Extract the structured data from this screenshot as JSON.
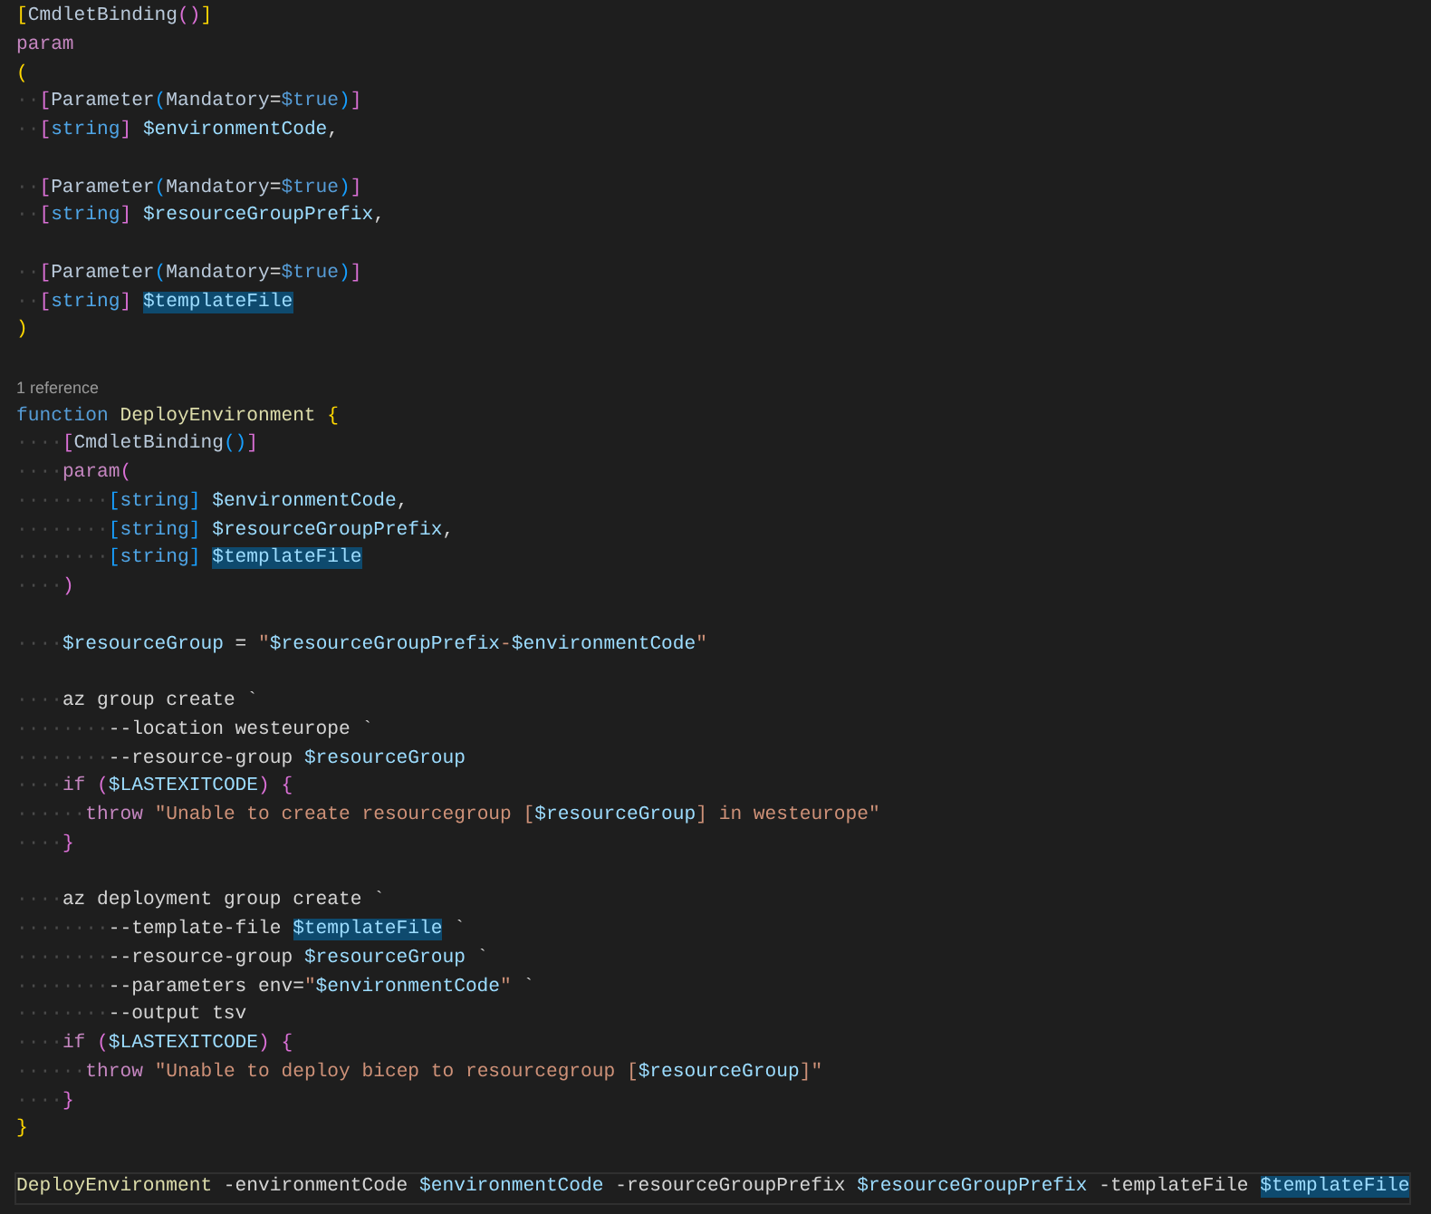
{
  "lines": [
    {
      "kind": "code",
      "tokens": [
        {
          "text": "[",
          "kind": "b1"
        },
        {
          "text": "CmdletBinding",
          "kind": "a"
        },
        {
          "text": "()",
          "kind": "b2"
        },
        {
          "text": "]",
          "kind": "b1"
        }
      ]
    },
    {
      "kind": "code",
      "tokens": [
        {
          "text": "param",
          "kind": "kw"
        }
      ]
    },
    {
      "kind": "code",
      "tokens": [
        {
          "text": "(",
          "kind": "b1"
        }
      ]
    },
    {
      "kind": "code",
      "indent": "··",
      "tokens": [
        {
          "text": "[",
          "kind": "b2"
        },
        {
          "text": "Parameter",
          "kind": "a"
        },
        {
          "text": "(",
          "kind": "b3"
        },
        {
          "text": "Mandatory",
          "kind": "a"
        },
        {
          "text": "=",
          "kind": "p"
        },
        {
          "text": "$true",
          "kind": "c"
        },
        {
          "text": ")",
          "kind": "b3"
        },
        {
          "text": "]",
          "kind": "b2"
        }
      ]
    },
    {
      "kind": "code",
      "indent": "··",
      "tokens": [
        {
          "text": "[",
          "kind": "b2"
        },
        {
          "text": "string",
          "kind": "t"
        },
        {
          "text": "] ",
          "kind": "b2"
        },
        {
          "text": "$environmentCode",
          "kind": "v"
        },
        {
          "text": ",",
          "kind": "p"
        }
      ]
    },
    {
      "kind": "blank"
    },
    {
      "kind": "code",
      "indent": "··",
      "tokens": [
        {
          "text": "[",
          "kind": "b2"
        },
        {
          "text": "Parameter",
          "kind": "a"
        },
        {
          "text": "(",
          "kind": "b3"
        },
        {
          "text": "Mandatory",
          "kind": "a"
        },
        {
          "text": "=",
          "kind": "p"
        },
        {
          "text": "$true",
          "kind": "c"
        },
        {
          "text": ")",
          "kind": "b3"
        },
        {
          "text": "]",
          "kind": "b2"
        }
      ]
    },
    {
      "kind": "code",
      "indent": "··",
      "tokens": [
        {
          "text": "[",
          "kind": "b2"
        },
        {
          "text": "string",
          "kind": "t"
        },
        {
          "text": "] ",
          "kind": "b2"
        },
        {
          "text": "$resourceGroupPrefix",
          "kind": "v"
        },
        {
          "text": ",",
          "kind": "p"
        }
      ]
    },
    {
      "kind": "blank"
    },
    {
      "kind": "code",
      "indent": "··",
      "tokens": [
        {
          "text": "[",
          "kind": "b2"
        },
        {
          "text": "Parameter",
          "kind": "a"
        },
        {
          "text": "(",
          "kind": "b3"
        },
        {
          "text": "Mandatory",
          "kind": "a"
        },
        {
          "text": "=",
          "kind": "p"
        },
        {
          "text": "$true",
          "kind": "c"
        },
        {
          "text": ")",
          "kind": "b3"
        },
        {
          "text": "]",
          "kind": "b2"
        }
      ]
    },
    {
      "kind": "code",
      "indent": "··",
      "tokens": [
        {
          "text": "[",
          "kind": "b2"
        },
        {
          "text": "string",
          "kind": "t"
        },
        {
          "text": "] ",
          "kind": "b2"
        },
        {
          "text": "$templateFile",
          "kind": "hv"
        }
      ]
    },
    {
      "kind": "code",
      "tokens": [
        {
          "text": ")",
          "kind": "b1"
        }
      ]
    },
    {
      "kind": "blank"
    },
    {
      "kind": "codelens",
      "tokens": [
        {
          "text": "1 reference",
          "kind": "lens"
        }
      ]
    },
    {
      "kind": "code",
      "tokens": [
        {
          "text": "function ",
          "kind": "fn"
        },
        {
          "text": "DeployEnvironment ",
          "kind": "nm"
        },
        {
          "text": "{",
          "kind": "b1"
        }
      ]
    },
    {
      "kind": "code",
      "indent": "····",
      "tokens": [
        {
          "text": "[",
          "kind": "b2"
        },
        {
          "text": "CmdletBinding",
          "kind": "a"
        },
        {
          "text": "()",
          "kind": "b3"
        },
        {
          "text": "]",
          "kind": "b2"
        }
      ]
    },
    {
      "kind": "code",
      "indent": "····",
      "tokens": [
        {
          "text": "param",
          "kind": "kw"
        },
        {
          "text": "(",
          "kind": "b2"
        }
      ]
    },
    {
      "kind": "code",
      "indent": "········",
      "tokens": [
        {
          "text": "[",
          "kind": "b3"
        },
        {
          "text": "string",
          "kind": "t"
        },
        {
          "text": "] ",
          "kind": "b3"
        },
        {
          "text": "$environmentCode",
          "kind": "v"
        },
        {
          "text": ",",
          "kind": "p"
        }
      ]
    },
    {
      "kind": "code",
      "indent": "········",
      "tokens": [
        {
          "text": "[",
          "kind": "b3"
        },
        {
          "text": "string",
          "kind": "t"
        },
        {
          "text": "] ",
          "kind": "b3"
        },
        {
          "text": "$resourceGroupPrefix",
          "kind": "v"
        },
        {
          "text": ",",
          "kind": "p"
        }
      ]
    },
    {
      "kind": "code",
      "indent": "········",
      "tokens": [
        {
          "text": "[",
          "kind": "b3"
        },
        {
          "text": "string",
          "kind": "t"
        },
        {
          "text": "] ",
          "kind": "b3"
        },
        {
          "text": "$templateFile",
          "kind": "hv"
        }
      ]
    },
    {
      "kind": "code",
      "indent": "····",
      "tokens": [
        {
          "text": ")",
          "kind": "b2"
        }
      ]
    },
    {
      "kind": "blank"
    },
    {
      "kind": "code",
      "indent": "····",
      "tokens": [
        {
          "text": "$resourceGroup",
          "kind": "v"
        },
        {
          "text": " = ",
          "kind": "p"
        },
        {
          "text": "\"",
          "kind": "s"
        },
        {
          "text": "$resourceGroupPrefix",
          "kind": "v"
        },
        {
          "text": "-",
          "kind": "s"
        },
        {
          "text": "$environmentCode",
          "kind": "v"
        },
        {
          "text": "\"",
          "kind": "s"
        }
      ]
    },
    {
      "kind": "blank"
    },
    {
      "kind": "code",
      "indent": "····",
      "tokens": [
        {
          "text": "az group create `",
          "kind": "p"
        }
      ]
    },
    {
      "kind": "code",
      "indent": "········",
      "tokens": [
        {
          "text": "--location westeurope `",
          "kind": "p"
        }
      ]
    },
    {
      "kind": "code",
      "indent": "········",
      "tokens": [
        {
          "text": "--resource-group ",
          "kind": "p"
        },
        {
          "text": "$resourceGroup",
          "kind": "v"
        }
      ]
    },
    {
      "kind": "code",
      "indent": "····",
      "tokens": [
        {
          "text": "if ",
          "kind": "kw"
        },
        {
          "text": "(",
          "kind": "b2"
        },
        {
          "text": "$LASTEXITCODE",
          "kind": "v"
        },
        {
          "text": ") {",
          "kind": "b2"
        }
      ]
    },
    {
      "kind": "code",
      "indent": "······",
      "tokens": [
        {
          "text": "throw ",
          "kind": "kw"
        },
        {
          "text": "\"Unable to create resourcegroup [",
          "kind": "s"
        },
        {
          "text": "$resourceGroup",
          "kind": "v"
        },
        {
          "text": "] in westeurope\"",
          "kind": "s"
        }
      ]
    },
    {
      "kind": "code",
      "indent": "····",
      "tokens": [
        {
          "text": "}",
          "kind": "b2"
        }
      ]
    },
    {
      "kind": "blank"
    },
    {
      "kind": "code",
      "indent": "····",
      "tokens": [
        {
          "text": "az deployment group create `",
          "kind": "p"
        }
      ]
    },
    {
      "kind": "code",
      "indent": "········",
      "tokens": [
        {
          "text": "--template-file ",
          "kind": "p"
        },
        {
          "text": "$templateFile",
          "kind": "hv"
        },
        {
          "text": " `",
          "kind": "p"
        }
      ]
    },
    {
      "kind": "code",
      "indent": "········",
      "tokens": [
        {
          "text": "--resource-group ",
          "kind": "p"
        },
        {
          "text": "$resourceGroup",
          "kind": "v"
        },
        {
          "text": " `",
          "kind": "p"
        }
      ]
    },
    {
      "kind": "code",
      "indent": "········",
      "tokens": [
        {
          "text": "--parameters env=",
          "kind": "p"
        },
        {
          "text": "\"",
          "kind": "s"
        },
        {
          "text": "$environmentCode",
          "kind": "v"
        },
        {
          "text": "\"",
          "kind": "s"
        },
        {
          "text": " `",
          "kind": "p"
        }
      ]
    },
    {
      "kind": "code",
      "indent": "········",
      "tokens": [
        {
          "text": "--output tsv",
          "kind": "p"
        }
      ]
    },
    {
      "kind": "code",
      "indent": "····",
      "tokens": [
        {
          "text": "if ",
          "kind": "kw"
        },
        {
          "text": "(",
          "kind": "b2"
        },
        {
          "text": "$LASTEXITCODE",
          "kind": "v"
        },
        {
          "text": ") {",
          "kind": "b2"
        }
      ]
    },
    {
      "kind": "code",
      "indent": "······",
      "tokens": [
        {
          "text": "throw ",
          "kind": "kw"
        },
        {
          "text": "\"Unable to deploy bicep to resourcegroup [",
          "kind": "s"
        },
        {
          "text": "$resourceGroup",
          "kind": "v"
        },
        {
          "text": "]\"",
          "kind": "s"
        }
      ]
    },
    {
      "kind": "code",
      "indent": "····",
      "tokens": [
        {
          "text": "}",
          "kind": "b2"
        }
      ]
    },
    {
      "kind": "code",
      "tokens": [
        {
          "text": "}",
          "kind": "b1"
        }
      ]
    },
    {
      "kind": "blank"
    },
    {
      "kind": "current",
      "tokens": [
        {
          "text": "DeployEnvironment",
          "kind": "nm"
        },
        {
          "text": " -environmentCode ",
          "kind": "p"
        },
        {
          "text": "$environmentCode",
          "kind": "v"
        },
        {
          "text": " -resourceGroupPrefix ",
          "kind": "p"
        },
        {
          "text": "$resourceGroupPrefix",
          "kind": "v"
        },
        {
          "text": " -templateFile ",
          "kind": "p"
        },
        {
          "text": "$templateFile",
          "kind": "hv"
        }
      ]
    }
  ]
}
